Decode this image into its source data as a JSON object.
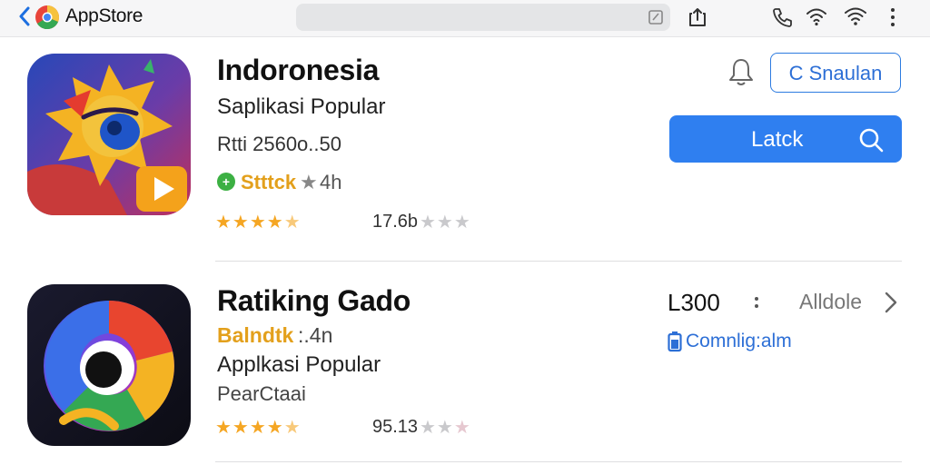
{
  "header": {
    "title": "AppStore",
    "icons": [
      "back-chevron-icon",
      "app-logo",
      "edit-icon",
      "upload-icon",
      "phone-icon",
      "hotspot-icon",
      "wifi-icon",
      "more-vertical-icon"
    ]
  },
  "apps": [
    {
      "title": "Indoronesia",
      "subtitle": "Saplikasi Popular",
      "price": "Rtti 2560o..50",
      "tag": "Stttck",
      "tag_rating": "4h",
      "stars": 4.5,
      "count": "17.6b",
      "bell_icon": "bell-icon",
      "outline_button": "C Snaulan",
      "primary_button": "Latck",
      "primary_icon": "search-icon"
    },
    {
      "title": "Ratiking Gado",
      "subtitle_highlight": "Balndtk",
      "subtitle_suffix": ":.4n",
      "subtitle": "Applkasi Popular",
      "category": "PearCtaai",
      "stars": 4.5,
      "count": "95.13",
      "price": "L300",
      "see_all": "Alldole",
      "link": "Comnlig:alm",
      "link_icon": "battery-icon"
    }
  ],
  "colors": {
    "accent": "#2f7ff0",
    "star": "#f5a623",
    "orange": "#f0a020",
    "green": "#3cb043"
  }
}
